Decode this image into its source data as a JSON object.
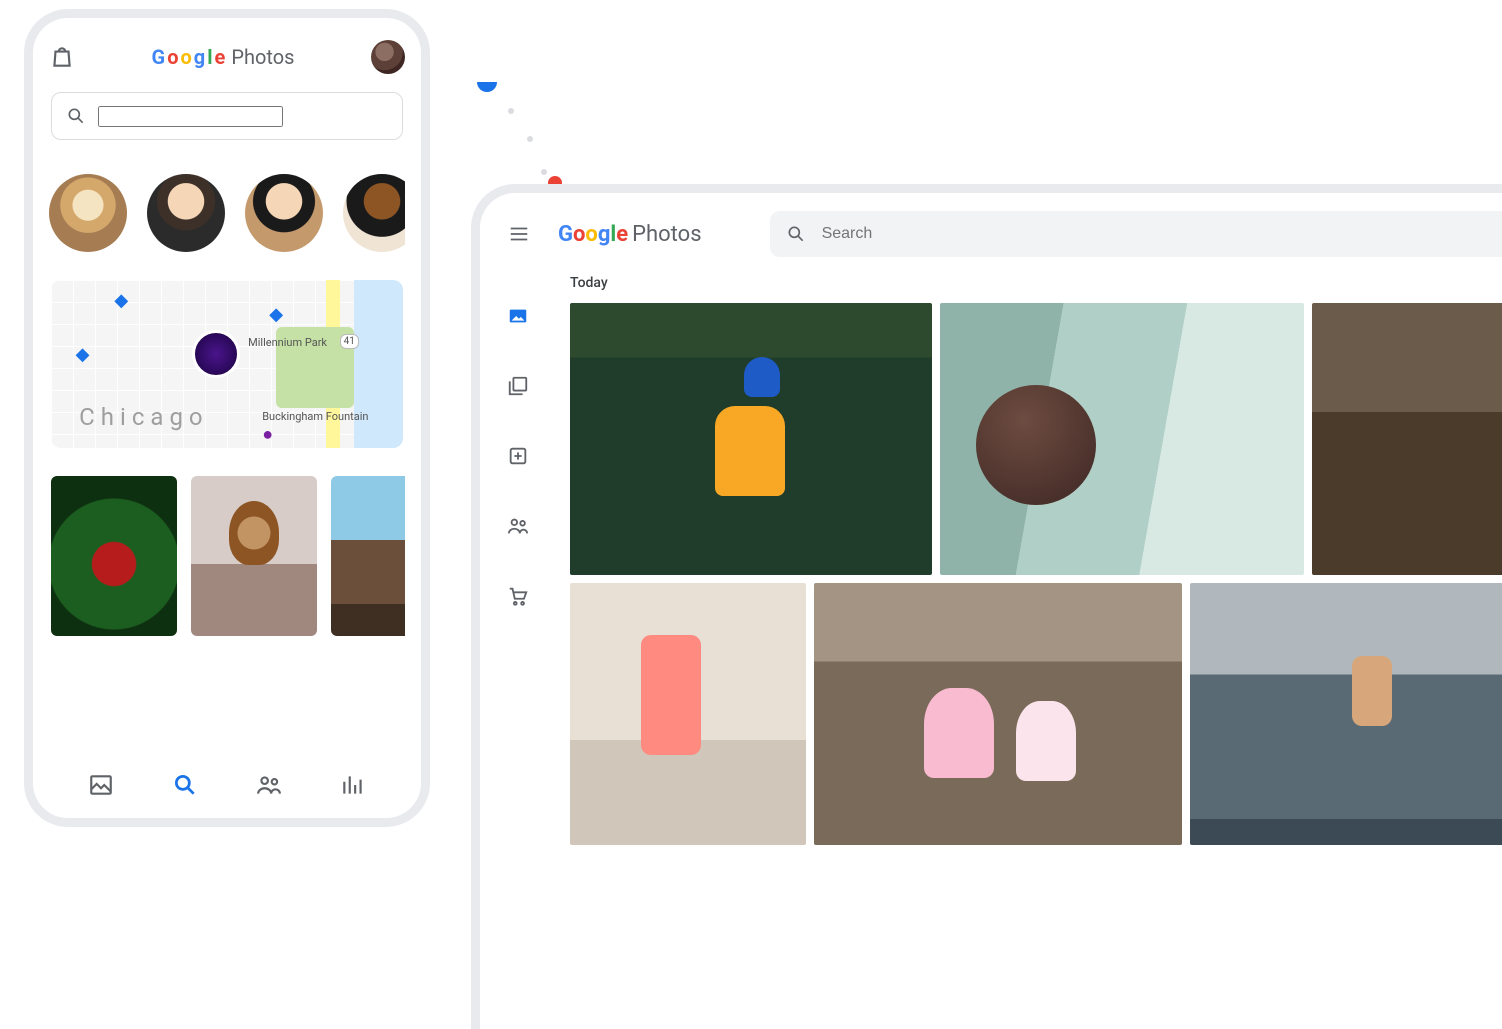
{
  "phone": {
    "logo": {
      "g1": "G",
      "g2": "o",
      "g3": "o",
      "g4": "g",
      "g5": "l",
      "g6": "e",
      "product": "Photos"
    },
    "bag_icon": "shopping-bag-icon",
    "avatar": "user-avatar",
    "search_placeholder": "",
    "faces": [
      {
        "name": "face-dog"
      },
      {
        "name": "face-man"
      },
      {
        "name": "face-woman-1"
      },
      {
        "name": "face-woman-2"
      }
    ],
    "map": {
      "city": "Chicago",
      "place_label_1": "Millennium Park",
      "place_label_2": "Buckingham Fountain",
      "route_badge": "41"
    },
    "thumbs": [
      {
        "name": "thumb-strawberries"
      },
      {
        "name": "thumb-dog-beach"
      },
      {
        "name": "thumb-landscape"
      }
    ],
    "tabs": [
      {
        "name": "photos-tab",
        "icon": "image-icon"
      },
      {
        "name": "search-tab",
        "icon": "search-icon"
      },
      {
        "name": "sharing-tab",
        "icon": "people-icon"
      },
      {
        "name": "library-tab",
        "icon": "library-icon"
      }
    ]
  },
  "desktop": {
    "menu_icon": "menu-icon",
    "logo": {
      "g1": "G",
      "g2": "o",
      "g3": "o",
      "g4": "g",
      "g5": "l",
      "g6": "e",
      "product": "Photos"
    },
    "search_placeholder": "Search",
    "rail": [
      {
        "name": "photos",
        "icon": "image-icon",
        "active": true
      },
      {
        "name": "explore",
        "icon": "albums-icon"
      },
      {
        "name": "sharing",
        "icon": "assistant-icon"
      },
      {
        "name": "library",
        "icon": "people-icon"
      },
      {
        "name": "print-store",
        "icon": "cart-icon"
      }
    ],
    "section_title": "Today",
    "photos_row1": [
      {
        "name": "photo-forest-child"
      },
      {
        "name": "photo-family-couch"
      },
      {
        "name": "photo-kitchen"
      }
    ],
    "photos_row2": [
      {
        "name": "photo-mother-daughter"
      },
      {
        "name": "photo-kids-floor"
      },
      {
        "name": "photo-lake-dive"
      }
    ]
  }
}
